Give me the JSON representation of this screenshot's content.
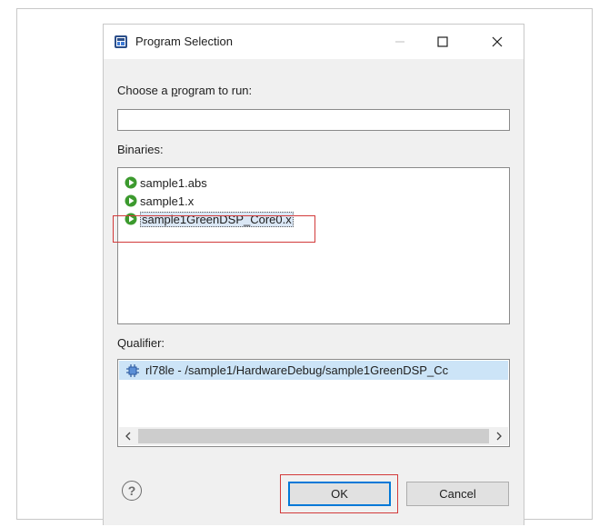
{
  "window": {
    "title": "Program Selection",
    "icon": "eclipse-app-icon",
    "controls": [
      "minimize",
      "maximize",
      "close"
    ]
  },
  "choose_label": {
    "pre": "Choose a ",
    "mnemonic": "p",
    "post": "rogram to run:"
  },
  "program_input": {
    "value": ""
  },
  "binaries": {
    "label": "Binaries:",
    "items": [
      {
        "label": "sample1.abs",
        "icon": "run-binary-icon"
      },
      {
        "label": "sample1.x",
        "icon": "run-binary-icon"
      },
      {
        "label": "sample1GreenDSP_Core0.x",
        "icon": "run-binary-icon",
        "selected": true
      }
    ]
  },
  "qualifier": {
    "label": "Qualifier:",
    "items": [
      {
        "label": "rl78le - /sample1/HardwareDebug/sample1GreenDSP_Cc",
        "icon": "chip-icon",
        "selected": true
      }
    ]
  },
  "buttons": {
    "ok": "OK",
    "cancel": "Cancel",
    "help": "?"
  },
  "colors": {
    "highlight_box": "#d23a3a",
    "selection": "#cce4f7",
    "default_button_border": "#0078d7"
  }
}
